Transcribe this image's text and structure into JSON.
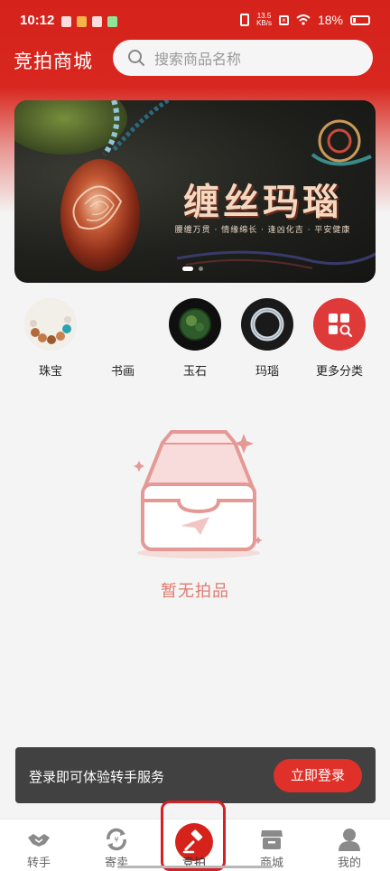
{
  "status_bar": {
    "time": "10:12",
    "net_speed_value": "13.5",
    "net_speed_unit": "KB/s",
    "battery": "18%"
  },
  "header": {
    "title": "竞拍商城",
    "search_placeholder": "搜索商品名称",
    "search_icon": "search-icon"
  },
  "banner": {
    "title": "缠丝玛瑙",
    "subtitle": "腰缠万贯 · 情缘绵长 · 逢凶化吉 · 平安健康",
    "slides_total": 2,
    "active_slide": 1
  },
  "categories": [
    {
      "label": "珠宝",
      "icon": "bead-bracelet-image"
    },
    {
      "label": "书画",
      "icon": "painting-image"
    },
    {
      "label": "玉石",
      "icon": "jade-image"
    },
    {
      "label": "玛瑙",
      "icon": "agate-bracelet-image"
    },
    {
      "label": "更多分类",
      "icon": "more-categories-icon"
    }
  ],
  "empty_state": {
    "text": "暂无拍品",
    "icon": "empty-box-icon"
  },
  "login_bar": {
    "text": "登录即可体验转手服务",
    "button": "立即登录"
  },
  "bottom_nav": [
    {
      "label": "转手",
      "icon": "handshake-icon",
      "active": false
    },
    {
      "label": "寄卖",
      "icon": "exchange-icon",
      "active": false
    },
    {
      "label": "竞拍",
      "icon": "gavel-icon",
      "active": true
    },
    {
      "label": "商城",
      "icon": "store-icon",
      "active": false
    },
    {
      "label": "我的",
      "icon": "profile-icon",
      "active": false
    }
  ],
  "colors": {
    "brand_red": "#d5231c",
    "empty_text": "#e07a70",
    "login_bar_bg": "#414141",
    "login_button": "#e0302a"
  }
}
